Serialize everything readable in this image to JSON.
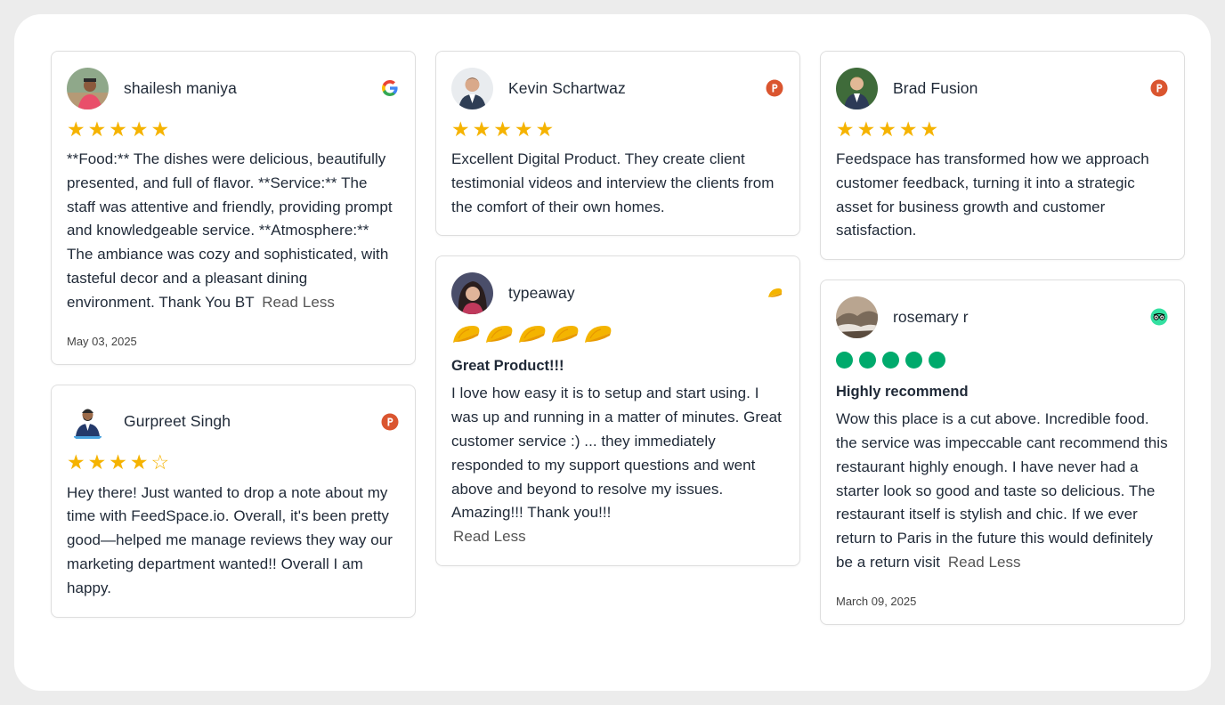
{
  "reviews": [
    {
      "name": "shailesh maniya",
      "source_icon": "google-icon",
      "rating": 5,
      "text": "**Food:** The dishes were delicious, beautifully presented, and full of flavor. **Service:** The staff was attentive and friendly, providing prompt and knowledgeable service. **Atmosphere:** The ambiance was cozy and sophisticated, with tasteful decor and a pleasant dining environment. Thank You BT",
      "read_less": "Read Less",
      "date": "May 03, 2025"
    },
    {
      "name": "Gurpreet Singh",
      "source_icon": "producthunt-icon",
      "rating": 4,
      "text": "Hey there! Just wanted to drop a note about my time with FeedSpace.io. Overall, it's been pretty good—helped me manage reviews they way our marketing department wanted!! Overall I am happy."
    },
    {
      "name": "Kevin Schartwaz",
      "source_icon": "producthunt-icon",
      "rating": 5,
      "text": "Excellent Digital Product. They create client testimonial videos and interview the clients from the comfort of their own homes."
    },
    {
      "name": "typeaway",
      "source_icon": "taco-icon",
      "rating": 5,
      "title": "Great Product!!!",
      "text": "I love how easy it is to setup and start using. I was up and running in a matter of minutes. Great customer service :) ... they immediately responded to my support questions and went above and beyond to resolve my issues. Amazing!!! Thank you!!!",
      "read_less": "Read Less"
    },
    {
      "name": "Brad Fusion",
      "source_icon": "producthunt-icon",
      "rating": 5,
      "text": "Feedspace has transformed how we approach customer feedback, turning it into a strategic asset for business growth and customer satisfaction."
    },
    {
      "name": "rosemary r",
      "source_icon": "tripadvisor-icon",
      "rating": 5,
      "title": "Highly recommend",
      "text": "Wow this place is a cut above. Incredible food. the service was impeccable cant recommend this restaurant highly enough. I have never had a starter look so good and taste so delicious. The restaurant itself is stylish and chic. If we ever return to Paris in the future this would definitely be a return visit",
      "read_less": "Read Less",
      "date": "March 09, 2025"
    }
  ],
  "colors": {
    "star": "#f5b301",
    "producthunt": "#da552f",
    "tripadvisor": "#00aa6c",
    "taco": "#f4b400"
  }
}
